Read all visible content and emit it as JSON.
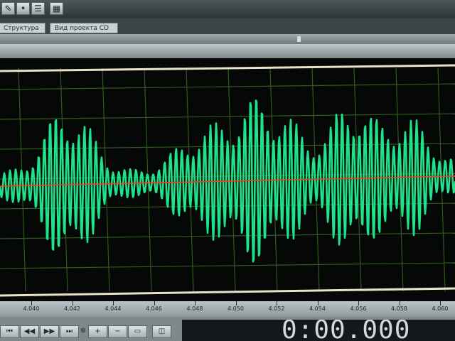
{
  "toolbar": {
    "buttons": [
      {
        "icon": "pencil-icon",
        "glyph": "✎"
      },
      {
        "icon": "dot-icon",
        "glyph": "•"
      },
      {
        "icon": "lines-icon",
        "glyph": "☰"
      },
      {
        "icon": "grid-icon",
        "glyph": "▦"
      }
    ]
  },
  "tabs": [
    "Структура",
    "Вид проекта CD"
  ],
  "waveform": {
    "wave_color": "#1fe38a",
    "baseline_color": "#ff3b1a",
    "grid_color": "#2f5a22",
    "border_color": "#e8e2c8"
  },
  "ruler": {
    "labels": [
      "4.040",
      "4.042",
      "4.044",
      "4.046",
      "4.048",
      "4.050",
      "4.052",
      "4.054",
      "4.056",
      "4.058",
      "4.060"
    ]
  },
  "transport": {
    "buttons": [
      {
        "icon": "rewind-start-icon",
        "glyph": "⏮"
      },
      {
        "icon": "rewind-icon",
        "glyph": "◀◀"
      },
      {
        "icon": "forward-icon",
        "glyph": "▶▶"
      },
      {
        "icon": "forward-end-icon",
        "glyph": "⏭"
      },
      {
        "icon": "zoom-icon",
        "glyph": "⊕"
      },
      {
        "icon": "zoom-in-icon",
        "glyph": "+"
      },
      {
        "icon": "zoom-out-icon",
        "glyph": "−"
      },
      {
        "icon": "zoom-full-icon",
        "glyph": "▭"
      },
      {
        "icon": "zoom-selection-icon",
        "glyph": "◫"
      }
    ],
    "time": "0:00.000"
  }
}
